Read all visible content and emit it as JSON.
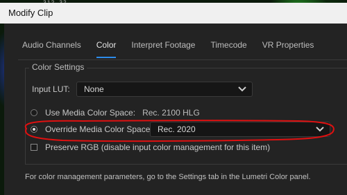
{
  "backdrop": {
    "ruler_text": "312    32"
  },
  "window": {
    "title": "Modify Clip"
  },
  "tabs": [
    {
      "label": "Audio Channels",
      "active": false
    },
    {
      "label": "Color",
      "active": true
    },
    {
      "label": "Interpret Footage",
      "active": false
    },
    {
      "label": "Timecode",
      "active": false
    },
    {
      "label": "VR Properties",
      "active": false
    }
  ],
  "color_settings": {
    "group_label": "Color Settings",
    "input_lut": {
      "label": "Input LUT:",
      "value": "None"
    },
    "use_media": {
      "label": "Use Media Color Space:",
      "value": "Rec. 2100 HLG",
      "selected": false
    },
    "override": {
      "label": "Override Media Color Space:",
      "value": "Rec. 2020",
      "selected": true
    },
    "preserve_rgb": {
      "label": "Preserve RGB (disable input color management for this item)",
      "checked": false
    }
  },
  "footer": {
    "text": "For color management parameters, go to the Settings tab in the Lumetri Color panel."
  },
  "colors": {
    "accent": "#2d8ceb",
    "annotation": "#e01010",
    "background": "#232323"
  },
  "icons": {
    "dropdown": "chevron-down-icon"
  }
}
